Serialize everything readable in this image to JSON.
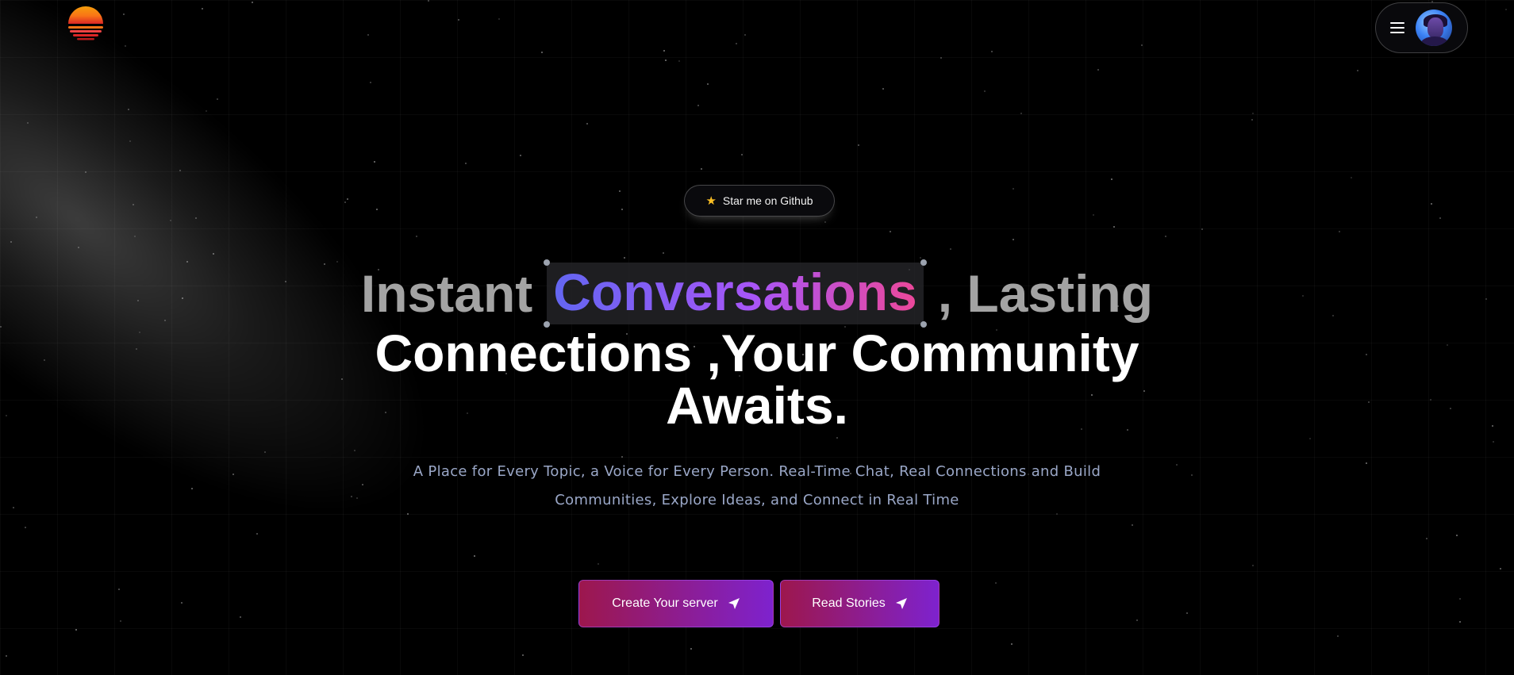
{
  "header": {
    "logo_icon": "sunset-logo",
    "menu_icon": "hamburger-icon",
    "avatar_icon": "user-avatar"
  },
  "badge": {
    "icon": "star-icon",
    "label": "Star me on Github"
  },
  "hero": {
    "headline_prefix": "Instant",
    "headline_highlight": "Conversations",
    "headline_suffix": ", Lasting",
    "headline_line2": "Connections ,Your Community",
    "headline_line3": "Awaits.",
    "subtitle_line1": "A Place for Every Topic, a Voice for Every Person. Real-Time Chat, Real Connections and Build",
    "subtitle_line2": "Communities, Explore Ideas, and Connect in Real Time"
  },
  "actions": {
    "create_label": "Create Your server",
    "read_label": "Read Stories",
    "button_icon": "send-arrow-icon"
  },
  "colors": {
    "background": "#000000",
    "highlight_gradient_start": "#6366f1",
    "highlight_gradient_end": "#ec4899",
    "button_gradient_start": "#9d174d",
    "button_gradient_end": "#7e22ce",
    "subtitle": "#9aa7c7"
  }
}
